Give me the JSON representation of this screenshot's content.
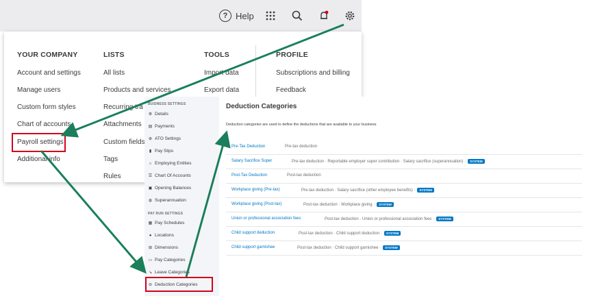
{
  "topbar": {
    "help_label": "Help",
    "icons": [
      "help-icon",
      "apps-grid-icon",
      "search-icon",
      "notification-bell-icon",
      "gear-icon"
    ]
  },
  "menu": {
    "your_company": {
      "heading": "YOUR COMPANY",
      "items": [
        "Account and settings",
        "Manage users",
        "Custom form styles",
        "Chart of accounts",
        "Payroll settings",
        "Additional info"
      ]
    },
    "lists": {
      "heading": "LISTS",
      "items": [
        "All lists",
        "Products and services",
        "Recurring tra",
        "Attachments",
        "Custom fields",
        "Tags",
        "Rules"
      ]
    },
    "tools": {
      "heading": "TOOLS",
      "items": [
        "Import data",
        "Export data"
      ]
    },
    "profile": {
      "heading": "PROFILE",
      "items": [
        "Subscriptions and billing",
        "Feedback"
      ]
    }
  },
  "settings_nav": {
    "business_heading": "BUSINESS SETTINGS",
    "business_items": [
      {
        "label": "Details",
        "icon": "gear-icon"
      },
      {
        "label": "Payments",
        "icon": "payments-icon"
      },
      {
        "label": "ATO Settings",
        "icon": "ato-icon"
      },
      {
        "label": "Pay Slips",
        "icon": "payslip-icon"
      },
      {
        "label": "Employing Entities",
        "icon": "bank-icon"
      },
      {
        "label": "Chart Of Accounts",
        "icon": "list-icon"
      },
      {
        "label": "Opening Balances",
        "icon": "balance-icon"
      },
      {
        "label": "Superannuation",
        "icon": "superannuation-icon"
      }
    ],
    "payrun_heading": "PAY RUN SETTINGS",
    "payrun_items": [
      {
        "label": "Pay Schedules",
        "icon": "calendar-icon"
      },
      {
        "label": "Locations",
        "icon": "location-icon"
      },
      {
        "label": "Dimensions",
        "icon": "dimensions-icon"
      },
      {
        "label": "Pay Categories",
        "icon": "pay-categories-icon"
      },
      {
        "label": "Leave Categories",
        "icon": "leave-icon"
      },
      {
        "label": "Deduction Categories",
        "icon": "deduction-icon"
      }
    ]
  },
  "content": {
    "title": "Deduction Categories",
    "description": "Deduction categories are used to define the deductions that are available to your business",
    "rows": [
      {
        "name": "Pre-Tax Deduction",
        "desc": "Pre-tax deduction",
        "badge": ""
      },
      {
        "name": "Salary Sacrifice Super",
        "desc": "Pre-tax deduction  ·  Reportable employer super contribution  ·  Salary sacrifice (superannuation)  ·",
        "badge": "SYSTEM"
      },
      {
        "name": "Post-Tax Deduction",
        "desc": "Post-tax deduction",
        "badge": ""
      },
      {
        "name": "Workplace giving (Pre-tax)",
        "desc": "Pre-tax deduction  ·  Salary sacrifice (other employee benefits)  ·",
        "badge": "SYSTEM"
      },
      {
        "name": "Workplace giving (Post-tax)",
        "desc": "Post-tax deduction  ·  Workplace giving  ·",
        "badge": "SYSTEM"
      },
      {
        "name": "Union or professional association fees",
        "desc": "Post-tax deduction  ·  Union or professional association fees  ·",
        "badge": "SYSTEM"
      },
      {
        "name": "Child support deduction",
        "desc": "Post-tax deduction  ·  Child support deduction  ·",
        "badge": "SYSTEM"
      },
      {
        "name": "Child support garnishee",
        "desc": "Post-tax deduction  ·  Child support garnishee  ·",
        "badge": "SYSTEM"
      }
    ]
  },
  "colors": {
    "highlight_box": "#d0021b",
    "arrow": "#1a7f5a",
    "link": "#0077c5",
    "badge": "#0077c5"
  }
}
